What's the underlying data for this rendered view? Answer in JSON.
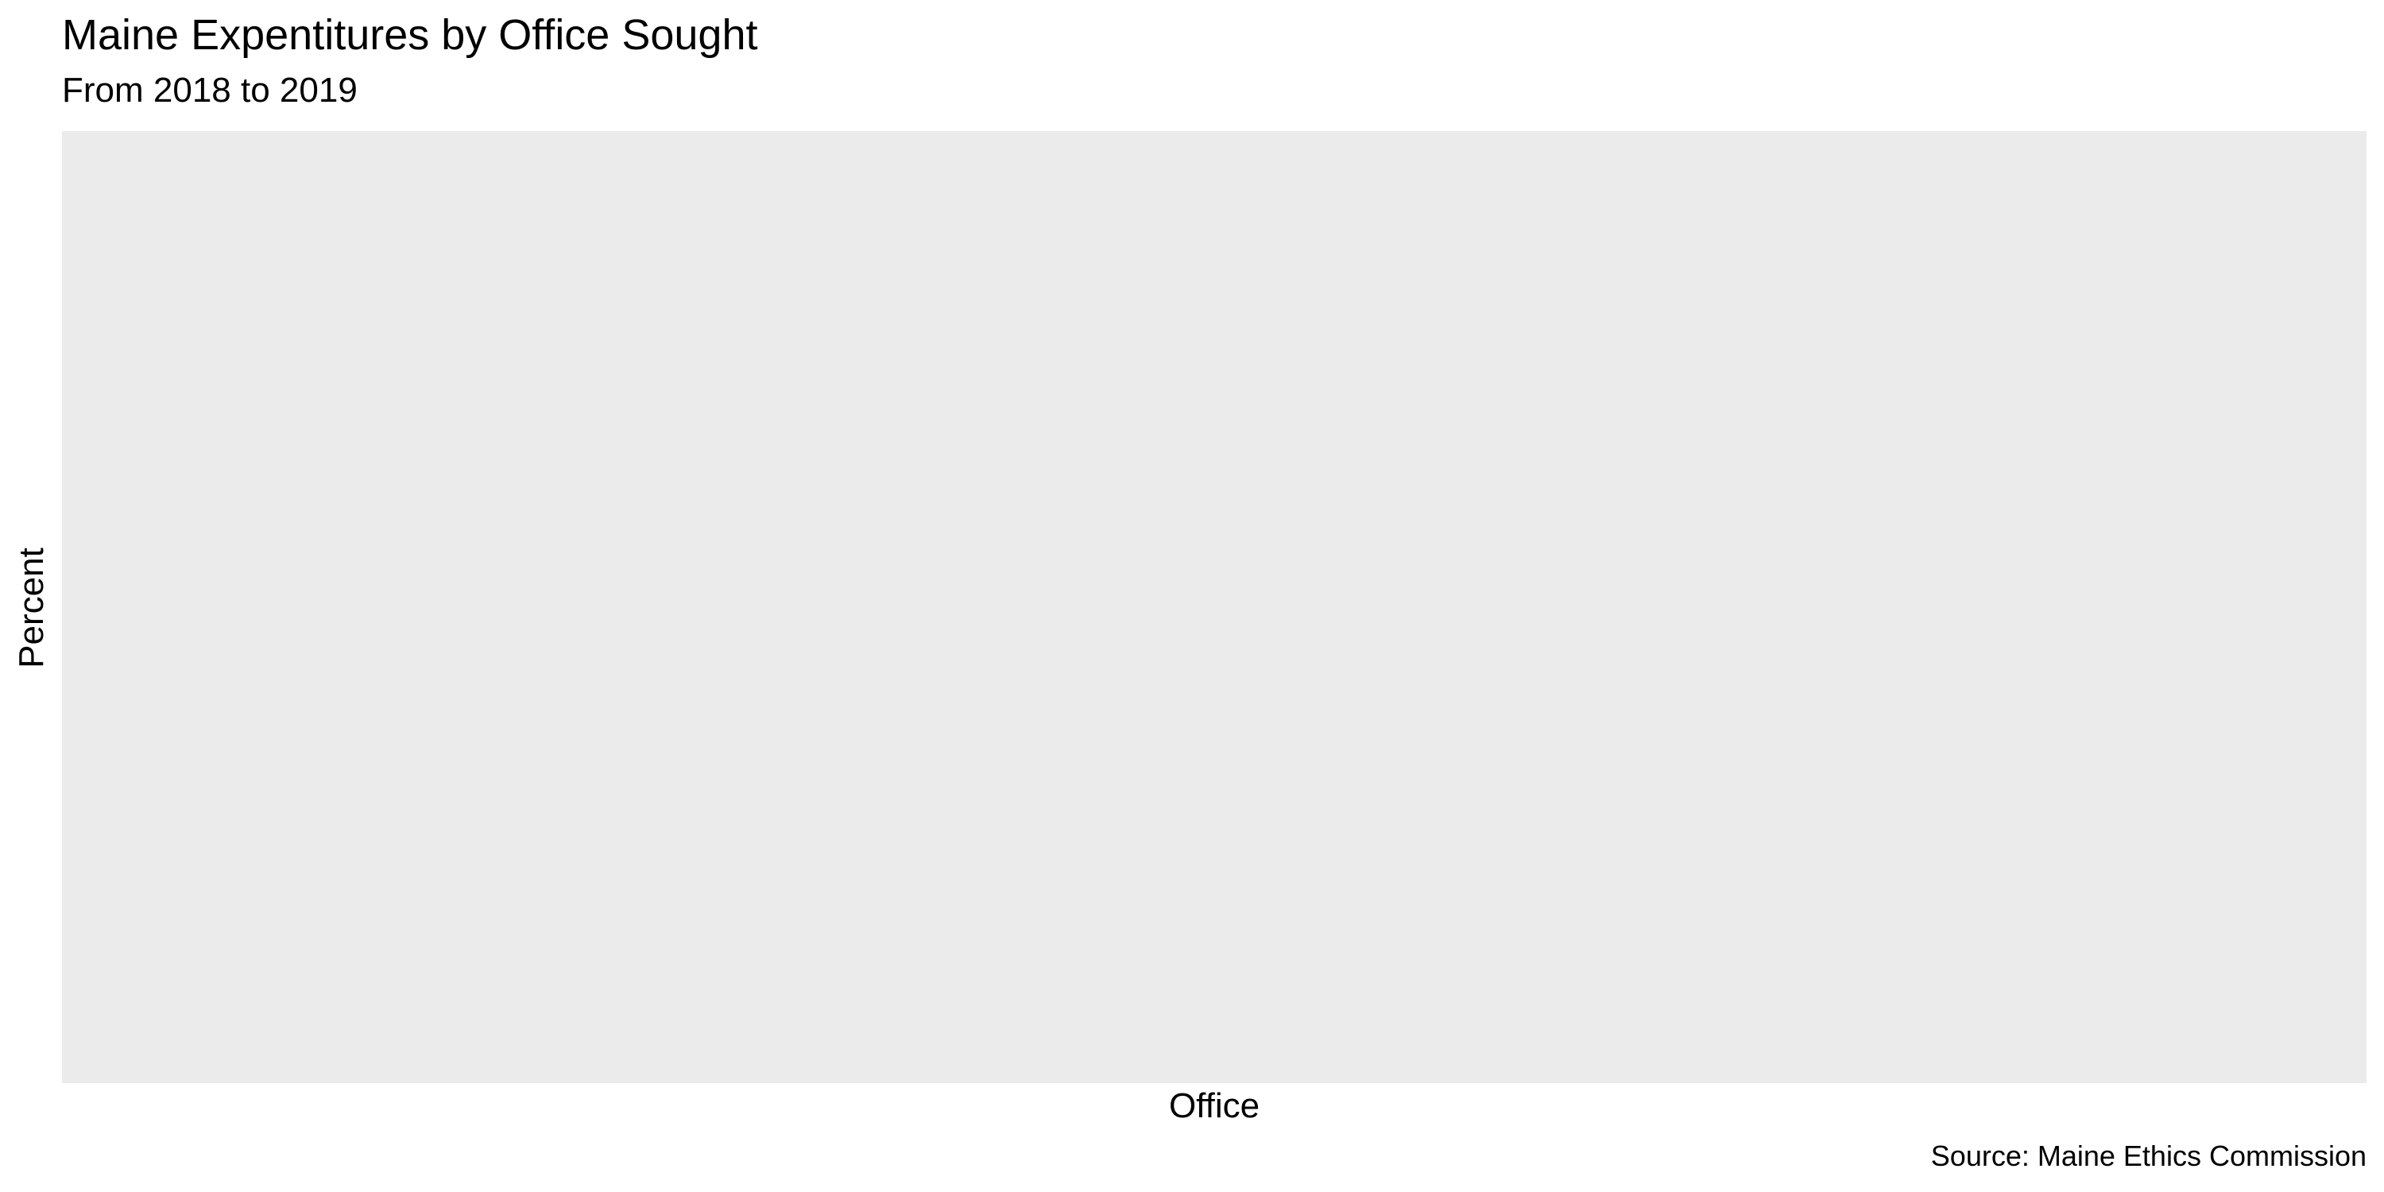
{
  "chart_data": {
    "type": "bar",
    "title": "Maine Expentitures by Office Sought",
    "subtitle": "From 2018 to 2019",
    "xlabel": "Office",
    "ylabel": "Percent",
    "caption": "Source: Maine Ethics Commission",
    "categories": [],
    "values": [],
    "grid": false,
    "panel_background": "#ebebeb",
    "legend": "none"
  }
}
